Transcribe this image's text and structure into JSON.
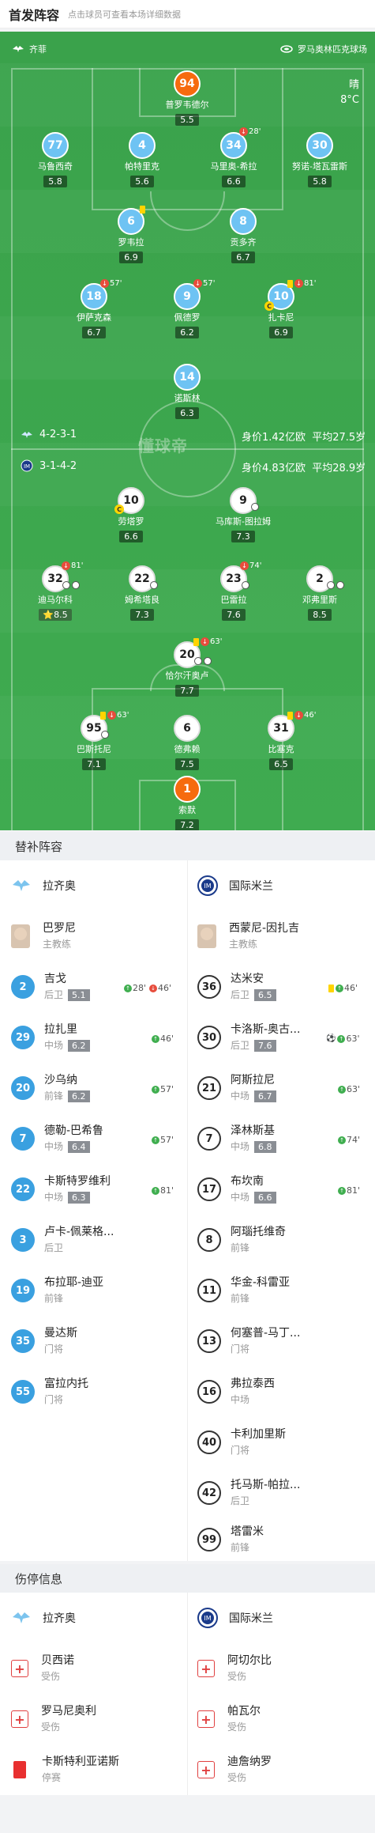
{
  "header": {
    "title": "首发阵容",
    "subtitle": "点击球员可查看本场详细数据"
  },
  "pitch": {
    "home_team": "齐菲",
    "venue": "罗马奥林匹克球场",
    "weather": "晴",
    "temperature": "8°C",
    "home_formation": "4-2-3-1",
    "home_value": "身价1.42亿欧",
    "home_age": "平均27.5岁",
    "away_formation": "3-1-4-2",
    "away_value": "身价4.83亿欧",
    "away_age": "平均28.9岁",
    "watermark": "懂球帝"
  },
  "home_players": [
    {
      "num": "94",
      "name": "普罗韦德尔",
      "rating": "5.5"
    },
    {
      "num": "77",
      "name": "马鲁西奇",
      "rating": "5.8"
    },
    {
      "num": "4",
      "name": "帕特里克",
      "rating": "5.6"
    },
    {
      "num": "34",
      "name": "马里奥-希拉",
      "rating": "6.6",
      "sub": "28'"
    },
    {
      "num": "30",
      "name": "努诺-塔瓦雷斯",
      "rating": "5.8"
    },
    {
      "num": "6",
      "name": "罗韦拉",
      "rating": "6.9"
    },
    {
      "num": "8",
      "name": "贡多齐",
      "rating": "6.7"
    },
    {
      "num": "18",
      "name": "伊萨克森",
      "rating": "6.7",
      "sub": "57'"
    },
    {
      "num": "9",
      "name": "佩德罗",
      "rating": "6.2",
      "sub": "57'"
    },
    {
      "num": "10",
      "name": "扎卡尼",
      "rating": "6.9",
      "sub": "81'"
    },
    {
      "num": "14",
      "name": "诺斯林",
      "rating": "6.3"
    }
  ],
  "away_players": [
    {
      "num": "10",
      "name": "劳塔罗",
      "rating": "6.6"
    },
    {
      "num": "9",
      "name": "马库斯-图拉姆",
      "rating": "7.3"
    },
    {
      "num": "32",
      "name": "迪马尔科",
      "rating": "8.5",
      "sub": "81'"
    },
    {
      "num": "22",
      "name": "姆希塔良",
      "rating": "7.3"
    },
    {
      "num": "23",
      "name": "巴雷拉",
      "rating": "7.6",
      "sub": "74'"
    },
    {
      "num": "2",
      "name": "邓弗里斯",
      "rating": "8.5"
    },
    {
      "num": "20",
      "name": "恰尔汗奥卢",
      "rating": "7.7",
      "sub": "63'"
    },
    {
      "num": "95",
      "name": "巴斯托尼",
      "rating": "7.1",
      "sub": "63'"
    },
    {
      "num": "6",
      "name": "德弗赖",
      "rating": "7.5"
    },
    {
      "num": "31",
      "name": "比塞克",
      "rating": "6.5",
      "sub": "46'"
    },
    {
      "num": "1",
      "name": "索默",
      "rating": "7.2"
    }
  ],
  "subs": {
    "title": "替补阵容",
    "home_team": "拉齐奥",
    "away_team": "国际米兰",
    "home_coach": {
      "name": "巴罗尼",
      "role": "主教练"
    },
    "away_coach": {
      "name": "西蒙尼-因扎吉",
      "role": "主教练"
    },
    "home": [
      {
        "num": "2",
        "name": "吉戈",
        "pos": "后卫",
        "rating": "5.1",
        "in": "28'",
        "out": "46'"
      },
      {
        "num": "29",
        "name": "拉扎里",
        "pos": "中场",
        "rating": "6.2",
        "in": "46'"
      },
      {
        "num": "20",
        "name": "沙乌纳",
        "pos": "前锋",
        "rating": "6.2",
        "in": "57'"
      },
      {
        "num": "7",
        "name": "德勒-巴希鲁",
        "pos": "中场",
        "rating": "6.4",
        "in": "57'"
      },
      {
        "num": "22",
        "name": "卡斯特罗维利",
        "pos": "中场",
        "rating": "6.3",
        "in": "81'"
      },
      {
        "num": "3",
        "name": "卢卡-佩莱格...",
        "pos": "后卫"
      },
      {
        "num": "19",
        "name": "布拉耶-迪亚",
        "pos": "前锋"
      },
      {
        "num": "35",
        "name": "曼达斯",
        "pos": "门将"
      },
      {
        "num": "55",
        "name": "富拉内托",
        "pos": "门将"
      }
    ],
    "away": [
      {
        "num": "36",
        "name": "达米安",
        "pos": "后卫",
        "rating": "6.5",
        "in": "46'"
      },
      {
        "num": "30",
        "name": "卡洛斯-奥古...",
        "pos": "后卫",
        "rating": "7.6",
        "in": "63'"
      },
      {
        "num": "21",
        "name": "阿斯拉尼",
        "pos": "中场",
        "rating": "6.7",
        "in": "63'"
      },
      {
        "num": "7",
        "name": "泽林斯基",
        "pos": "中场",
        "rating": "6.8",
        "in": "74'"
      },
      {
        "num": "17",
        "name": "布坎南",
        "pos": "中场",
        "rating": "6.6",
        "in": "81'"
      },
      {
        "num": "8",
        "name": "阿瑙托维奇",
        "pos": "前锋"
      },
      {
        "num": "11",
        "name": "华金-科雷亚",
        "pos": "前锋"
      },
      {
        "num": "13",
        "name": "何塞普-马丁...",
        "pos": "门将"
      },
      {
        "num": "16",
        "name": "弗拉泰西",
        "pos": "中场"
      },
      {
        "num": "40",
        "name": "卡利加里斯",
        "pos": "门将"
      },
      {
        "num": "42",
        "name": "托马斯-帕拉...",
        "pos": "后卫"
      },
      {
        "num": "99",
        "name": "塔雷米",
        "pos": "前锋"
      }
    ]
  },
  "injuries": {
    "title": "伤停信息",
    "home_team": "拉齐奥",
    "away_team": "国际米兰",
    "home": [
      {
        "name": "贝西诺",
        "status": "受伤",
        "icon": "injury-icon"
      },
      {
        "name": "罗马尼奥利",
        "status": "受伤",
        "icon": "injury-icon"
      },
      {
        "name": "卡斯特利亚诺斯",
        "status": "停赛",
        "icon": "red-card-icon"
      }
    ],
    "away": [
      {
        "name": "阿切尔比",
        "status": "受伤",
        "icon": "injury-icon"
      },
      {
        "name": "帕瓦尔",
        "status": "受伤",
        "icon": "injury-icon"
      },
      {
        "name": "迪詹纳罗",
        "status": "受伤",
        "icon": "injury-icon"
      }
    ]
  }
}
